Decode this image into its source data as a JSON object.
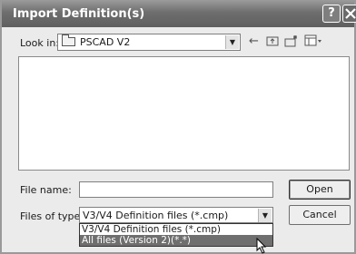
{
  "window": {
    "title": "Import Definition(s)"
  },
  "titlebar": {
    "help_glyph": "?",
    "close_glyph": "✕"
  },
  "lookin": {
    "label": "Look in:",
    "value": "PSCAD V2"
  },
  "filename": {
    "label": "File name:",
    "value": ""
  },
  "filetype": {
    "label": "Files of type:",
    "value": "V3/V4 Definition files (*.cmp)",
    "options": [
      "V3/V4 Definition files (*.cmp)",
      "All files (Version 2)(*.*)"
    ],
    "highlighted_option": "All files (Version 2)(*.*)"
  },
  "buttons": {
    "open": "Open",
    "cancel": "Cancel"
  },
  "icons": {
    "back": "←",
    "up": "⤴",
    "new_folder": "✱",
    "view": "☷"
  }
}
